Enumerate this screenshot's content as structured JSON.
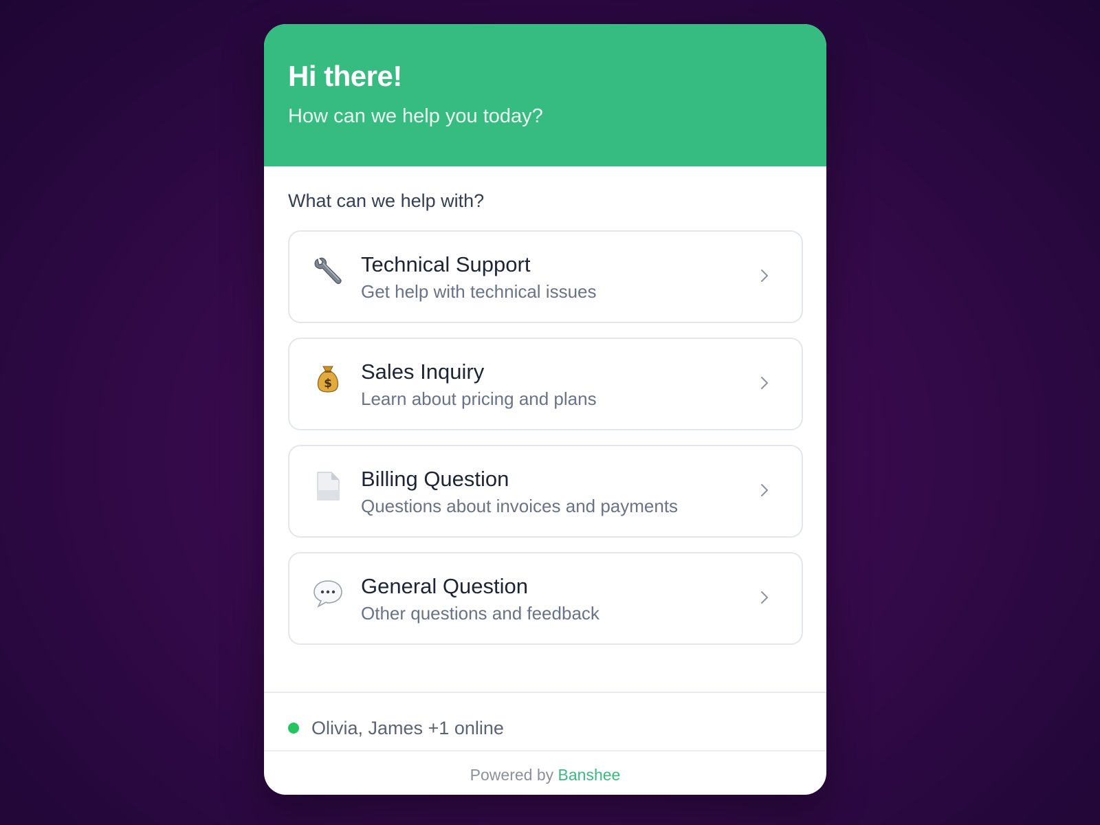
{
  "header": {
    "title": "Hi there!",
    "subtitle": "How can we help you today?"
  },
  "section_label": "What can we help with?",
  "options": [
    {
      "icon": "wrench-icon",
      "title": "Technical Support",
      "description": "Get help with technical issues"
    },
    {
      "icon": "money-bag-icon",
      "title": "Sales Inquiry",
      "description": "Learn about pricing and plans"
    },
    {
      "icon": "document-icon",
      "title": "Billing Question",
      "description": "Questions about invoices and payments"
    },
    {
      "icon": "speech-bubble-icon",
      "title": "General Question",
      "description": "Other questions and feedback"
    }
  ],
  "status": {
    "online_text": "Olivia, James +1 online",
    "dot_color": "#22c55e"
  },
  "footer": {
    "powered_prefix": "Powered by",
    "brand_name": "Banshee"
  },
  "colors": {
    "accent": "#36bb80",
    "background": "#3a0b4e"
  }
}
